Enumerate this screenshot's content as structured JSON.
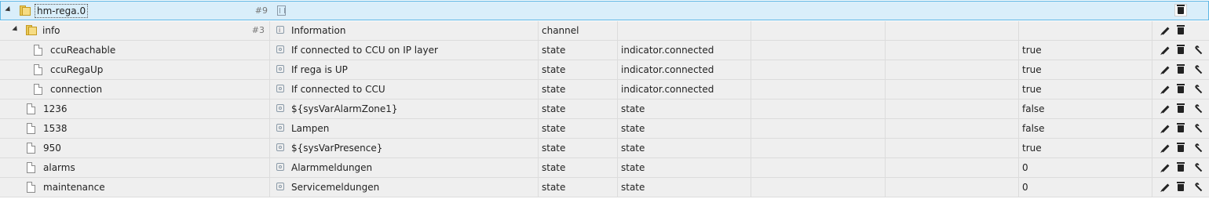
{
  "root": {
    "name": "hm-rega.0",
    "count": "#9"
  },
  "info": {
    "name": "info",
    "count": "#3",
    "description": "Information",
    "type": "channel"
  },
  "rows": [
    {
      "name": "ccuReachable",
      "description": "If connected to CCU on IP layer",
      "type": "state",
      "role": "indicator.connected",
      "value": "true"
    },
    {
      "name": "ccuRegaUp",
      "description": "If rega is UP",
      "type": "state",
      "role": "indicator.connected",
      "value": "true"
    },
    {
      "name": "connection",
      "description": "If connected to CCU",
      "type": "state",
      "role": "indicator.connected",
      "value": "true"
    },
    {
      "name": "1236",
      "description": "${sysVarAlarmZone1}",
      "type": "state",
      "role": "state",
      "value": "false"
    },
    {
      "name": "1538",
      "description": "Lampen",
      "type": "state",
      "role": "state",
      "value": "false"
    },
    {
      "name": "950",
      "description": "${sysVarPresence}",
      "type": "state",
      "role": "state",
      "value": "true"
    },
    {
      "name": "alarms",
      "description": "Alarmmeldungen",
      "type": "state",
      "role": "state",
      "value": "0"
    },
    {
      "name": "maintenance",
      "description": "Servicemeldungen",
      "type": "state",
      "role": "state",
      "value": "0"
    }
  ],
  "icons": {
    "folder": "folder-icon",
    "file": "file-icon",
    "edit": "pencil-icon",
    "delete": "trash-icon",
    "settings": "wrench-icon",
    "state": "state-icon",
    "channel": "channel-icon",
    "device": "device-icon"
  },
  "colors": {
    "selected_bg": "#d9eefa",
    "selected_border": "#5eb6e4",
    "row_bg": "#efefef",
    "folder": "#e9c85a"
  }
}
